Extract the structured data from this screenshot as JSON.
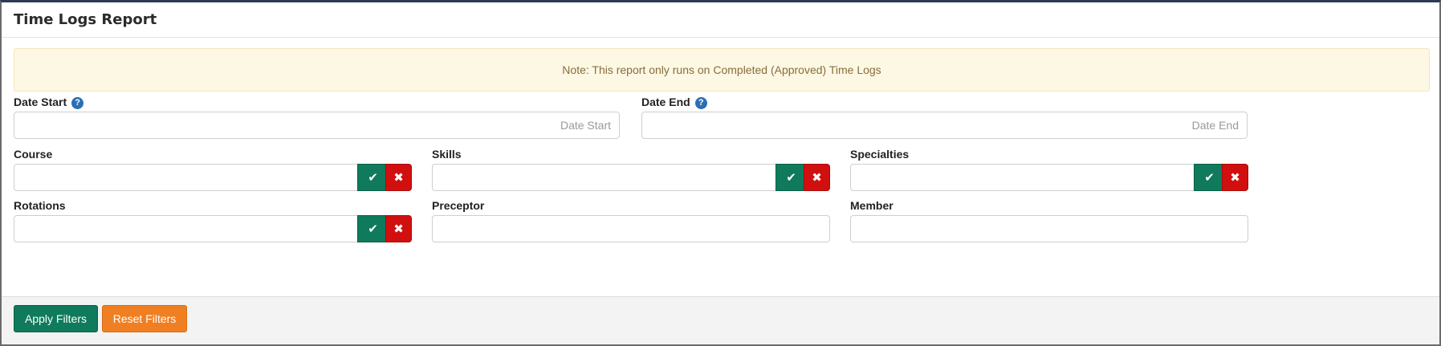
{
  "header": {
    "title": "Time Logs Report"
  },
  "note": "Note: This report only runs on Completed (Approved) Time Logs",
  "fields": {
    "date_start": {
      "label": "Date Start",
      "placeholder": "Date Start",
      "help_icon": "question-circle-icon"
    },
    "date_end": {
      "label": "Date End",
      "placeholder": "Date End",
      "help_icon": "question-circle-icon"
    },
    "course": {
      "label": "Course"
    },
    "skills": {
      "label": "Skills"
    },
    "specialties": {
      "label": "Specialties"
    },
    "rotations": {
      "label": "Rotations"
    },
    "preceptor": {
      "label": "Preceptor"
    },
    "member": {
      "label": "Member"
    }
  },
  "icons": {
    "confirm": "check-icon",
    "clear": "times-icon",
    "help": "?",
    "check_glyph": "✔",
    "x_glyph": "✖"
  },
  "footer": {
    "apply_label": "Apply Filters",
    "reset_label": "Reset Filters"
  },
  "colors": {
    "primary": "#0f7a5c",
    "danger": "#d10f0f",
    "warning": "#f07f22",
    "note_bg": "#fcf8e3",
    "note_text": "#8a6d3b"
  }
}
